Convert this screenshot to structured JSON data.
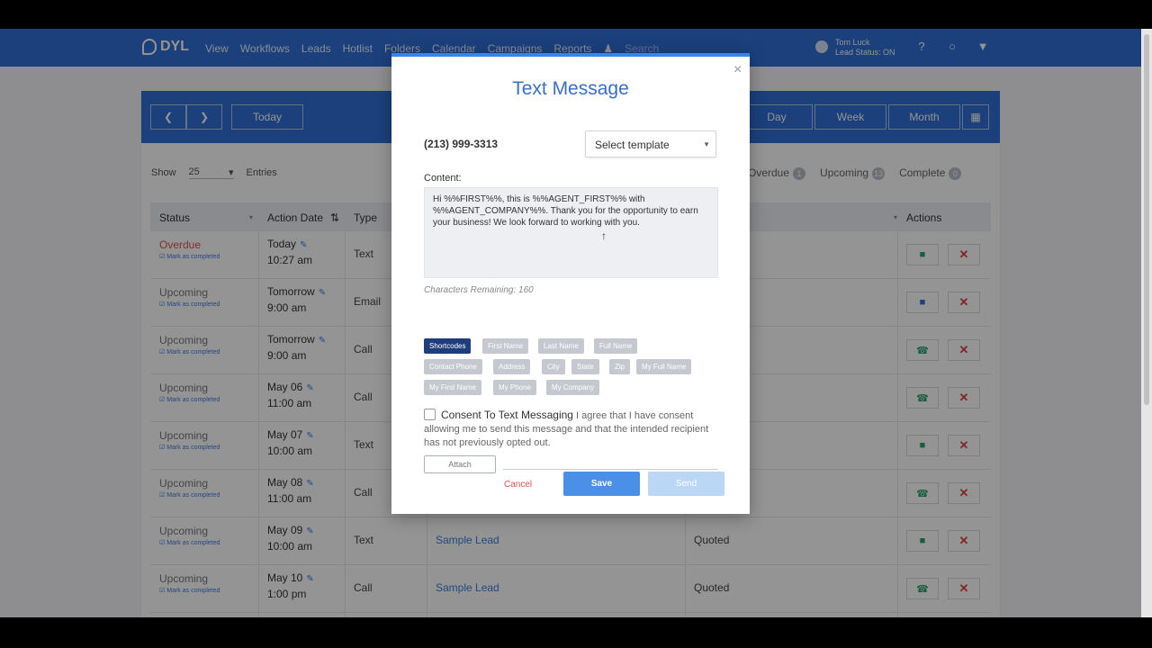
{
  "nav": {
    "logo": "DYL",
    "menu": [
      "View",
      "Workflows",
      "Leads",
      "Hotlist",
      "Folders",
      "Calendar",
      "Campaigns",
      "Reports"
    ],
    "search_placeholder": "Search",
    "user_name": "Tom Luck",
    "user_status": "Lead Status: ON"
  },
  "calendar": {
    "today_label": "Today",
    "views": [
      "Day",
      "Week",
      "Month"
    ],
    "show_label": "Show",
    "show_value": "25",
    "entries_label": "Entries",
    "tabs": [
      {
        "label": "Overdue",
        "count": "1"
      },
      {
        "label": "Upcoming",
        "count": "13"
      },
      {
        "label": "Complete",
        "count": "0"
      }
    ],
    "columns": {
      "status": "Status",
      "action_date": "Action Date",
      "type": "Type",
      "actions": "Actions"
    },
    "rows": [
      {
        "status": "Overdue",
        "mark": "Mark as completed",
        "date": "Today",
        "time": "10:27 am",
        "type": "Text",
        "lead": "",
        "quote": ""
      },
      {
        "status": "Upcoming",
        "mark": "Mark as completed",
        "date": "Tomorrow",
        "time": "9:00 am",
        "type": "Email",
        "lead": "",
        "quote": ""
      },
      {
        "status": "Upcoming",
        "mark": "Mark as completed",
        "date": "Tomorrow",
        "time": "9:00 am",
        "type": "Call",
        "lead": "",
        "quote": ""
      },
      {
        "status": "Upcoming",
        "mark": "Mark as completed",
        "date": "May 06",
        "time": "11:00 am",
        "type": "Call",
        "lead": "",
        "quote": ""
      },
      {
        "status": "Upcoming",
        "mark": "Mark as completed",
        "date": "May 07",
        "time": "10:00 am",
        "type": "Text",
        "lead": "",
        "quote": ""
      },
      {
        "status": "Upcoming",
        "mark": "Mark as completed",
        "date": "May 08",
        "time": "11:00 am",
        "type": "Call",
        "lead": "",
        "quote": ""
      },
      {
        "status": "Upcoming",
        "mark": "Mark as completed",
        "date": "May 09",
        "time": "10:00 am",
        "type": "Text",
        "lead": "Sample Lead",
        "quote": "Quoted"
      },
      {
        "status": "Upcoming",
        "mark": "Mark as completed",
        "date": "May 10",
        "time": "1:00 pm",
        "type": "Call",
        "lead": "Sample Lead",
        "quote": "Quoted"
      }
    ]
  },
  "modal": {
    "title": "Text Message",
    "phone": "(213) 999-3313",
    "template_placeholder": "Select template",
    "content_label": "Content:",
    "content_text": "Hi %%FIRST%%, this is %%AGENT_FIRST%% with %%AGENT_COMPANY%%. Thank you for the opportunity to earn your business! We look forward to working with you.",
    "remaining": "Characters Remaining: 160",
    "shortcodes": [
      "Shortcodes",
      "First Name",
      "Last Name",
      "Full Name",
      "Contact Phone",
      "Address",
      "City",
      "State",
      "Zip",
      "My Full Name",
      "My First Name",
      "My Phone",
      "My Company"
    ],
    "consent_title": "Consent To Text Messaging",
    "consent_text": "I agree that I have consent allowing me to send this message and that the intended recipient has not previously opted out.",
    "attach_label": "Attach",
    "cancel_label": "Cancel",
    "save_label": "Save",
    "send_label": "Send",
    "close_glyph": "×"
  },
  "colors": {
    "brand": "#2f6fd6",
    "accent": "#4a90e8",
    "danger": "#e05050",
    "success": "#2aa36b"
  }
}
